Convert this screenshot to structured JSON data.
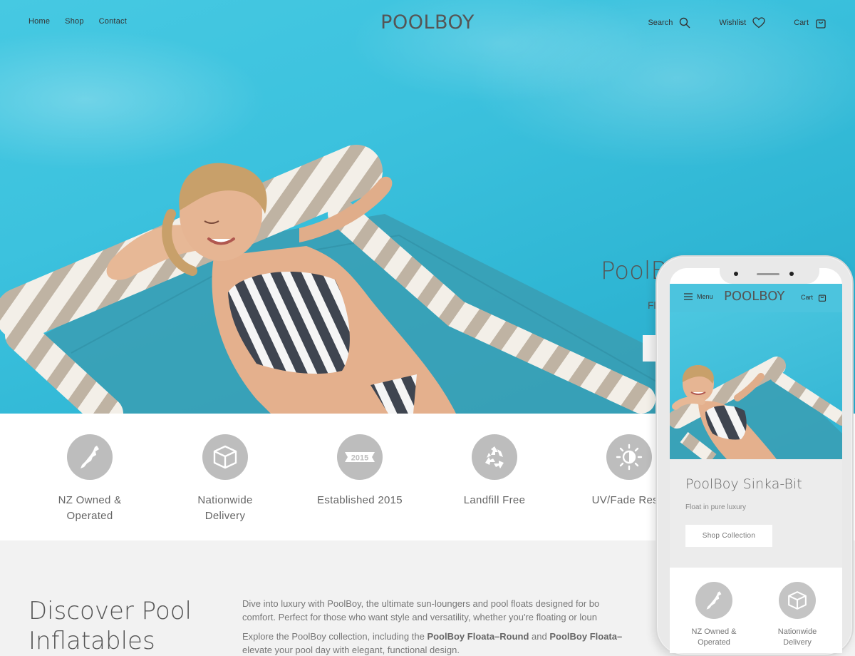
{
  "header": {
    "nav": [
      {
        "label": "Home"
      },
      {
        "label": "Shop"
      },
      {
        "label": "Contact"
      }
    ],
    "logo": "POOLBOY",
    "utilities": {
      "search": "Search",
      "wishlist": "Wishlist",
      "cart": "Cart"
    }
  },
  "hero": {
    "title": "PoolB",
    "subtitle": "Fl"
  },
  "features": [
    {
      "label": "NZ Owned &\nOperated",
      "icon": "nz-map-icon"
    },
    {
      "label": "Nationwide\nDelivery",
      "icon": "box-icon"
    },
    {
      "label": "Established 2015",
      "icon": "badge-2015-icon",
      "badge": "2015"
    },
    {
      "label": "Landfill Free",
      "icon": "recycle-icon"
    },
    {
      "label": "UV/Fade Resis",
      "icon": "sun-icon"
    }
  ],
  "discover": {
    "title_line1": "Discover Pool",
    "title_line2": "Inflatables",
    "p1_line1": "Dive into luxury with PoolBoy, the ultimate sun-loungers and pool floats designed for bo",
    "p1_line2": "comfort. Perfect for those who want style and versatility, whether you're floating or loun",
    "p2_pre": "Explore the PoolBoy collection, including the ",
    "p2_b1": "PoolBoy Floata–Round",
    "p2_mid": " and ",
    "p2_b2": "PoolBoy Floata–",
    "p2_line2": "elevate your pool day with elegant, functional design."
  },
  "mobile": {
    "menu": "Menu",
    "logo": "POOLBOY",
    "cart": "Cart",
    "title": "PoolBoy Sinka-Bit",
    "subtitle": "Float in pure luxury",
    "button": "Shop Collection",
    "features": [
      {
        "label": "NZ Owned &\nOperated",
        "icon": "nz-map-icon"
      },
      {
        "label": "Nationwide\nDelivery",
        "icon": "box-icon"
      }
    ]
  },
  "colors": {
    "pool": "#3cc2de",
    "icon_circle": "#bdbdbd",
    "section_bg": "#f2f2f2"
  }
}
